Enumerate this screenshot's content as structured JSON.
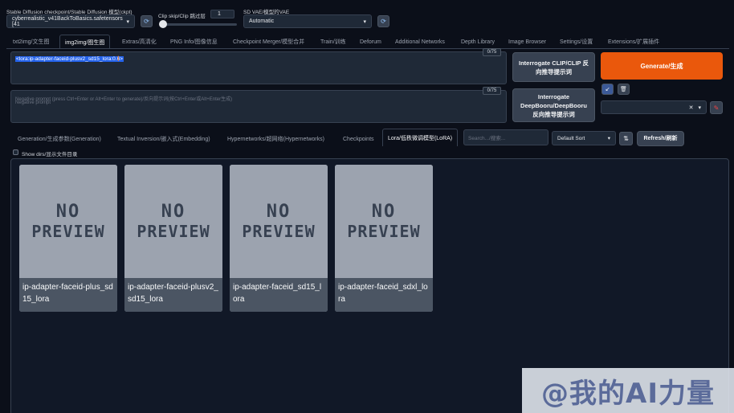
{
  "top": {
    "checkpoint_label": "Stable Diffusion checkpoint/Stable Diffusion 模型(ckpt)",
    "checkpoint_value": "cyberrealistic_v41BackToBasics.safetensors [41",
    "clip_label": "Clip skip/Clip 跳过层",
    "clip_value": "1",
    "vae_label": "SD VAE/模型的VAE",
    "vae_value": "Automatic"
  },
  "tabs": [
    "txt2img/文生图",
    "img2img/图生图",
    "Extras/高清化",
    "PNG Info/图像信息",
    "Checkpoint Merger/模型合并",
    "Train/训练",
    "Deforum",
    "Additional Networks",
    "Depth Library",
    "Image Browser",
    "Settings/设置",
    "Extensions/扩展插件"
  ],
  "prompt": {
    "text": "<lora:ip-adapter-faceid-plusv2_sd15_lora:0.6>",
    "counter": "0/75",
    "neg_placeholder": "Negative prompt (press Ctrl+Enter or Alt+Enter to generate)/反向提示词(按Ctrl+Enter或Alt+Enter生成)",
    "neg_placeholder2": "Negative prompt",
    "neg_counter": "0/75"
  },
  "buttons": {
    "interrogate_clip": "Interrogate CLIP/CLIP 反向推导提示词",
    "interrogate_deepbooru": "Interrogate DeepBooru/DeepBooru 反向推导提示词",
    "generate": "Generate/生成"
  },
  "subtabs": [
    "Generation/生成参数(Generation)",
    "Textual Inversion/嵌入式(Embedding)",
    "Hypernetworks/超网络(Hypernetworks)",
    "Checkpoints",
    "Lora/低秩微调模型(LoRA)"
  ],
  "search_placeholder": "Search.../搜索...",
  "sort_value": "Default Sort",
  "refresh_label": "Refresh/刷新",
  "show_dirs_label": "Show dirs/显示文件目录",
  "no_preview_line1": "NO",
  "no_preview_line2": "PREVIEW",
  "cards": [
    {
      "name": "ip-adapter-faceid-plus_sd15_lora"
    },
    {
      "name": "ip-adapter-faceid-plusv2_sd15_lora"
    },
    {
      "name": "ip-adapter-faceid_sd15_lora"
    },
    {
      "name": "ip-adapter-faceid_sdxl_lora"
    }
  ],
  "watermark": "@我的AI力量",
  "colors": {
    "accent": "#ea580c",
    "background": "#0b0f19",
    "selection": "#2563eb"
  }
}
